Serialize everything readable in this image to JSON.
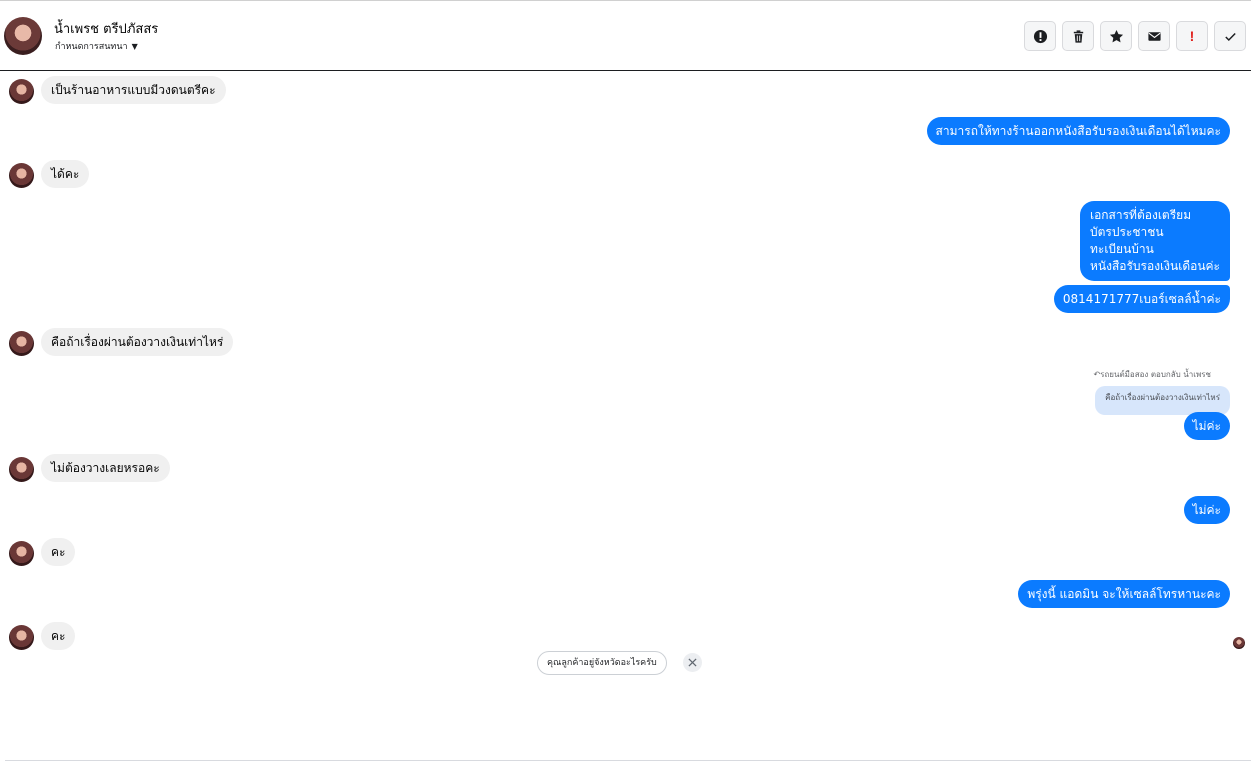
{
  "header": {
    "contact_name": "น้ำเพรช ตรีปภัสสร",
    "subtitle": "กำหนดการสนทนา",
    "toolbar": [
      {
        "name": "alert-button",
        "icon": "alert-circle-icon"
      },
      {
        "name": "delete-button",
        "icon": "trash-icon"
      },
      {
        "name": "star-button",
        "icon": "star-icon"
      },
      {
        "name": "mail-button",
        "icon": "envelope-icon"
      },
      {
        "name": "spam-button",
        "icon": "exclamation-icon",
        "label": "!"
      },
      {
        "name": "done-button",
        "icon": "check-icon"
      }
    ]
  },
  "messages": {
    "m1": "เป็นร้านอาหารแบบมีวงดนตรีคะ",
    "m2": "สามารถให้ทางร้านออกหนังสือรับรองเงินเดือนได้ไหมคะ",
    "m3": "ได้คะ",
    "m4_lines": [
      "เอกสารที่ต้องเตรียม",
      "บัตรประชาชน",
      "ทะเบียนบ้าน",
      "หนังสือรับรองเงินเดือนค่ะ"
    ],
    "m5": "0814171777เบอร์เซลล์น้ำค่ะ",
    "m6": "คือถ้าเรื่องผ่านต้องวางเงินเท่าไหร่",
    "m7_reply_meta": "รถยนต์มือสอง ตอบกลับ น้ำเพรช",
    "m7_quoted": "คือถ้าเรื่องผ่านต้องวางเงินเท่าไหร่",
    "m7": "ไม่ค่ะ",
    "m8": "ไม่ต้องวางเลยหรอคะ",
    "m9": "ไม่ค่ะ",
    "m10": "คะ",
    "m11": "พรุ่งนี้ แอดมิน จะให้เซลล์โทรหานะคะ",
    "m12": "คะ"
  },
  "suggestion": {
    "text": "คุณลูกค้าอยู่จังหวัดอะไรครับ"
  },
  "colors": {
    "outgoing": "#0b7bff",
    "incoming": "#f0f0f0",
    "quoted": "#d7e6fb",
    "spam_red": "#e0211d"
  }
}
